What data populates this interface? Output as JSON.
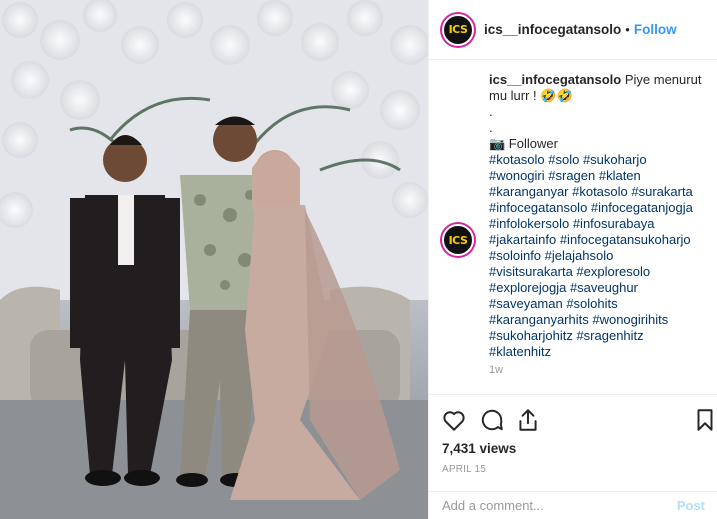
{
  "post": {
    "username": "ics__infocegatansolo",
    "avatar_text": "ICS",
    "follow_label": "Follow",
    "separator": "•",
    "caption_text": "Piye menurut mu lurr ! 🤣🤣",
    "caption_dots": [
      ".",
      "."
    ],
    "follower_line": "📷 Follower",
    "hashtags": [
      "#kotasolo #solo #sukoharjo",
      "#wonogiri #sragen #klaten",
      "#karanganyar #kotasolo #surakarta",
      "#infocegatansolo #infocegatanjogja",
      "#infolokersolo #infosurabaya",
      "#jakartainfo #infocegatansukoharjo",
      "#soloinfo #jelajahsolo",
      "#visitsurakarta #exploresolo",
      "#explorejogja #saveughur",
      "#saveyaman #solohits",
      "#karanganyarhits #wonogirihits",
      "#sukoharjohitz #sragenhitz",
      "#klatenhitz"
    ],
    "time_ago": "1w",
    "views": "7,431 views",
    "date": "APRIL 15",
    "comment_placeholder": "Add a comment...",
    "post_button": "Post"
  },
  "icons": {
    "like": "heart-icon",
    "comment": "comment-bubble-icon",
    "share": "share-icon",
    "save": "bookmark-icon"
  },
  "colors": {
    "follow": "#3897f0",
    "hashtag": "#003569",
    "post_disabled": "#b2dffc",
    "avatar_ring": "#d6249f",
    "avatar_text": "#f4d000"
  }
}
